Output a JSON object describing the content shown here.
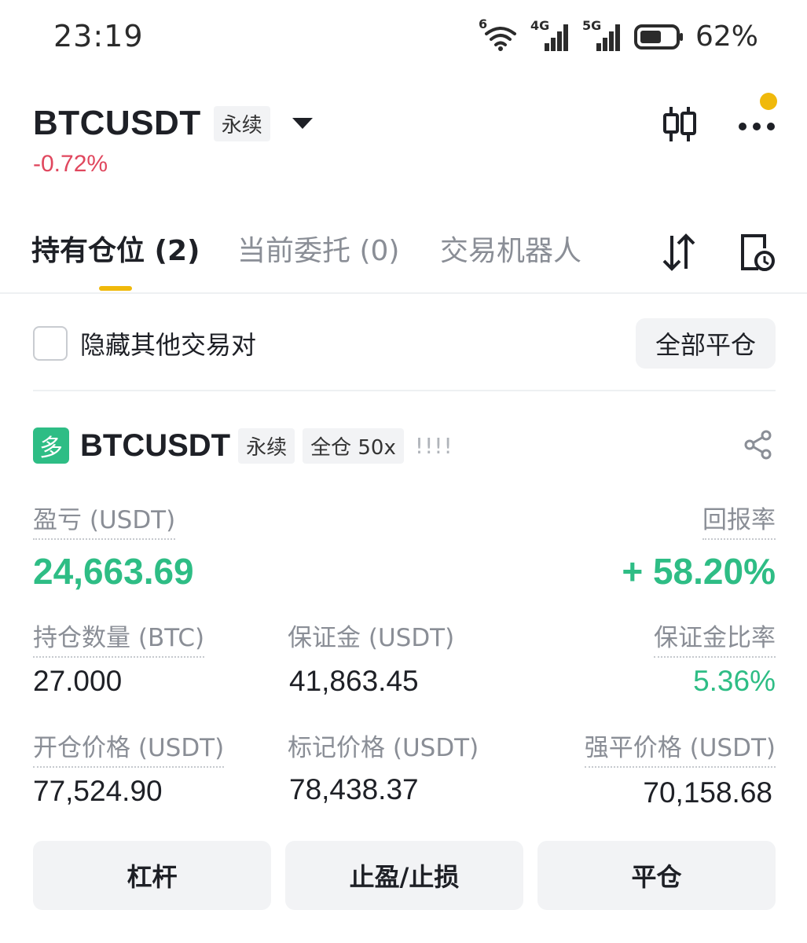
{
  "status_bar": {
    "time": "23:19",
    "wifi_badge": "6",
    "net1": "4G",
    "net2": "5G",
    "battery_percent": "62%",
    "battery_level": 0.62
  },
  "header": {
    "symbol": "BTCUSDT",
    "contract_tag": "永续",
    "change": "-0.72%",
    "notification_dot_color": "#f0b90b"
  },
  "tabs": [
    {
      "label": "持有仓位 (2)",
      "active": true
    },
    {
      "label": "当前委托 (0)",
      "active": false
    },
    {
      "label": "交易机器人",
      "active": false
    }
  ],
  "filter": {
    "hide_other_pairs_label": "隐藏其他交易对",
    "hide_other_pairs_checked": false,
    "close_all_label": "全部平仓"
  },
  "position": {
    "side_badge": "多",
    "symbol": "BTCUSDT",
    "contract_tag": "永续",
    "margin_mode_tag": "全仓 50x",
    "risk_bars": "!!!!",
    "pnl_label": "盈亏 (USDT)",
    "pnl_value": "24,663.69",
    "roe_label": "回报率",
    "roe_value": "+ 58.20%",
    "size_label": "持仓数量 (BTC)",
    "size_value": "27.000",
    "margin_label": "保证金 (USDT)",
    "margin_value": "41,863.45",
    "margin_ratio_label": "保证金比率",
    "margin_ratio_value": "5.36%",
    "entry_price_label": "开仓价格 (USDT)",
    "entry_price_value": "77,524.90",
    "mark_price_label": "标记价格 (USDT)",
    "mark_price_value": "78,438.37",
    "liq_price_label": "强平价格 (USDT)",
    "liq_price_value": "70,158.68"
  },
  "actions": {
    "leverage": "杠杆",
    "tp_sl": "止盈/止损",
    "close": "平仓"
  },
  "colors": {
    "profit": "#2ebd85",
    "loss": "#e0475e",
    "accent": "#f0b90b",
    "muted_text": "#8a8e96",
    "button_bg": "#f2f3f5"
  }
}
